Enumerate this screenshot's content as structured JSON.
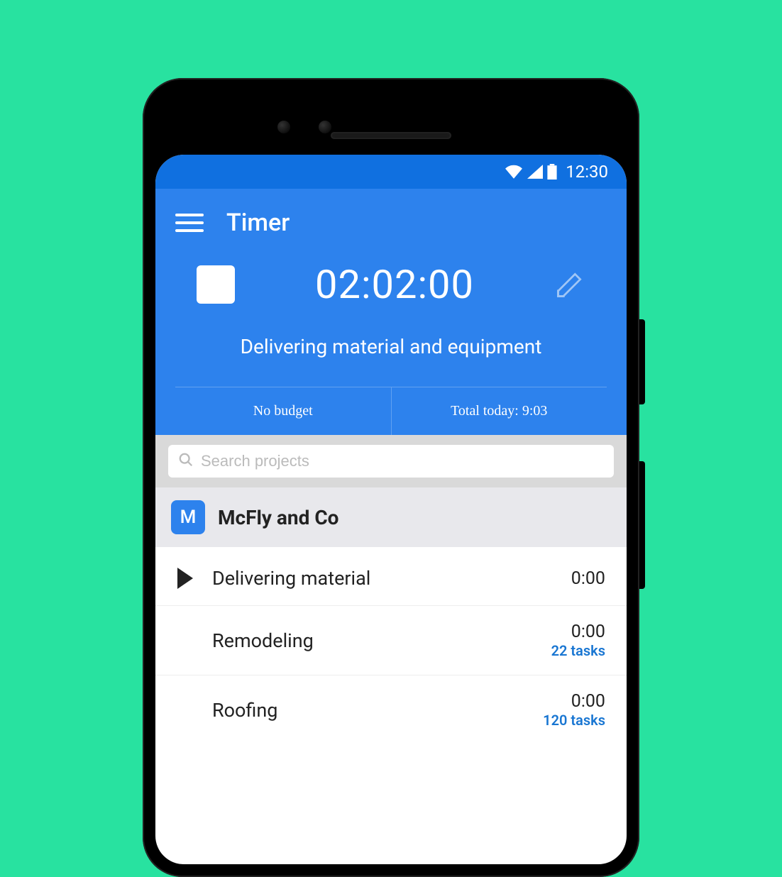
{
  "statusbar": {
    "time": "12:30"
  },
  "header": {
    "title": "Timer"
  },
  "timer": {
    "elapsed": "02:02:00",
    "description": "Delivering material and equipment"
  },
  "stats": {
    "budget": "No budget",
    "total_today": "Total today: 9:03"
  },
  "search": {
    "placeholder": "Search projects"
  },
  "project": {
    "badge_letter": "M",
    "name": "McFly and Co"
  },
  "tasks": [
    {
      "name": "Delivering material",
      "time": "0:00",
      "subtasks": "",
      "show_play": true
    },
    {
      "name": "Remodeling",
      "time": "0:00",
      "subtasks": "22 tasks",
      "show_play": false
    },
    {
      "name": "Roofing",
      "time": "0:00",
      "subtasks": "120 tasks",
      "show_play": false
    }
  ]
}
